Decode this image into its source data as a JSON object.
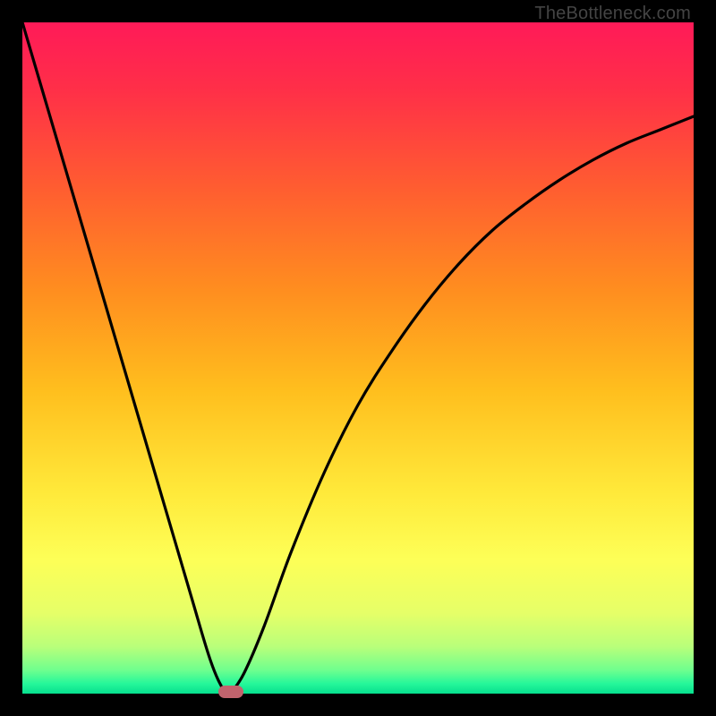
{
  "watermark": "TheBottleneck.com",
  "chart_data": {
    "type": "line",
    "title": "",
    "xlabel": "",
    "ylabel": "",
    "xlim": [
      0,
      100
    ],
    "ylim": [
      0,
      100
    ],
    "grid": false,
    "legend": false,
    "annotations": [],
    "series": [
      {
        "name": "left-branch",
        "x": [
          0,
          5,
          10,
          15,
          20,
          25,
          28,
          30,
          31
        ],
        "y": [
          100,
          83,
          66,
          49,
          32,
          15,
          5,
          0.5,
          0
        ]
      },
      {
        "name": "right-branch",
        "x": [
          31,
          33,
          36,
          40,
          45,
          50,
          55,
          60,
          65,
          70,
          75,
          80,
          85,
          90,
          95,
          100
        ],
        "y": [
          0,
          3,
          10,
          21,
          33,
          43,
          51,
          58,
          64,
          69,
          73,
          76.5,
          79.5,
          82,
          84,
          86
        ]
      }
    ],
    "marker": {
      "x": 31,
      "y": 0,
      "color": "#c1636d"
    },
    "gradient_stops": [
      {
        "offset": 0.0,
        "color": "#ff1a58"
      },
      {
        "offset": 0.1,
        "color": "#ff2f48"
      },
      {
        "offset": 0.25,
        "color": "#ff5e30"
      },
      {
        "offset": 0.4,
        "color": "#ff8e1f"
      },
      {
        "offset": 0.55,
        "color": "#ffbf1e"
      },
      {
        "offset": 0.7,
        "color": "#ffe93a"
      },
      {
        "offset": 0.8,
        "color": "#fdff57"
      },
      {
        "offset": 0.88,
        "color": "#e6ff68"
      },
      {
        "offset": 0.93,
        "color": "#b9ff7a"
      },
      {
        "offset": 0.965,
        "color": "#6fff8e"
      },
      {
        "offset": 0.985,
        "color": "#26f79a"
      },
      {
        "offset": 1.0,
        "color": "#06e08f"
      }
    ]
  }
}
